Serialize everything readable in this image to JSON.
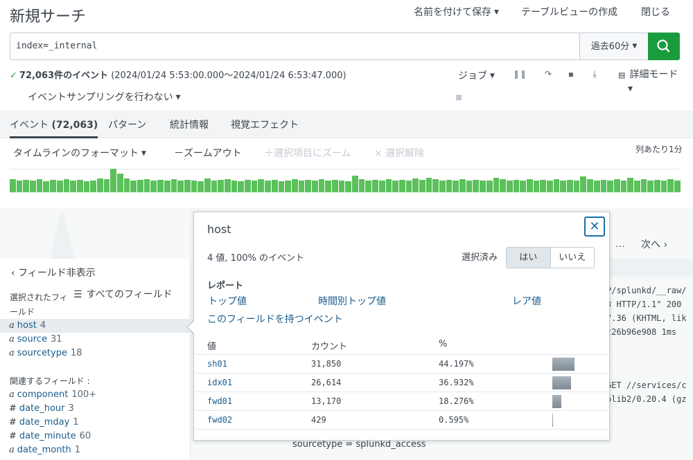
{
  "header": {
    "title": "新規サーチ",
    "save_as": "名前を付けて保存",
    "table_view": "テーブルビューの作成",
    "close": "閉じる"
  },
  "search": {
    "query": "index=_internal",
    "time_range": "過去60分"
  },
  "status": {
    "count_text": "72,063件のイベント",
    "range_text": "(2024/01/24 5:53:00.000～2024/01/24 6:53:47.000)",
    "sampling": "イベントサンプリングを行わない",
    "job": "ジョブ",
    "mode": "詳細モード"
  },
  "tabs": {
    "events_label": "イベント",
    "events_count": "(72,063)",
    "patterns": "パターン",
    "statistics": "統計情報",
    "visualization": "視覚エフェクト"
  },
  "timeline": {
    "format": "タイムラインのフォーマット",
    "zoom_out": "－ズームアウト",
    "zoom_selection": "＋選択項目にズーム",
    "deselect": "× 選択解除",
    "per_column": "列あたり1分",
    "bar_values": [
      0.55,
      0.5,
      0.52,
      0.5,
      0.55,
      0.48,
      0.52,
      0.5,
      0.55,
      0.5,
      0.52,
      0.48,
      0.5,
      0.6,
      0.55,
      1.0,
      0.8,
      0.58,
      0.5,
      0.52,
      0.55,
      0.5,
      0.52,
      0.5,
      0.55,
      0.5,
      0.52,
      0.5,
      0.48,
      0.6,
      0.5,
      0.52,
      0.55,
      0.5,
      0.48,
      0.52,
      0.5,
      0.55,
      0.5,
      0.52,
      0.48,
      0.5,
      0.55,
      0.5,
      0.52,
      0.5,
      0.55,
      0.5,
      0.52,
      0.5,
      0.48,
      0.7,
      0.55,
      0.5,
      0.52,
      0.5,
      0.55,
      0.5,
      0.52,
      0.5,
      0.58,
      0.52,
      0.62,
      0.55,
      0.5,
      0.52,
      0.5,
      0.55,
      0.5,
      0.52,
      0.5,
      0.5,
      0.62,
      0.55,
      0.5,
      0.52,
      0.5,
      0.55,
      0.5,
      0.52,
      0.5,
      0.55,
      0.5,
      0.52,
      0.5,
      0.68,
      0.55,
      0.5,
      0.52,
      0.5,
      0.55,
      0.5,
      0.62,
      0.5,
      0.55,
      0.5,
      0.52,
      0.5,
      0.55,
      0.5
    ]
  },
  "pagination": {
    "ellipsis": "…",
    "next": "次へ ›"
  },
  "sidebar": {
    "hide_fields": "‹ フィールド非表示",
    "all_fields": "すべてのフィールド",
    "selected_label": "選択されたフィールド",
    "related_label": "関連するフィールド :",
    "selected_fields": [
      {
        "type": "a",
        "name": "host",
        "count": "4"
      },
      {
        "type": "a",
        "name": "source",
        "count": "31"
      },
      {
        "type": "a",
        "name": "sourcetype",
        "count": "18"
      }
    ],
    "related_fields": [
      {
        "type": "a",
        "name": "component",
        "count": "100+"
      },
      {
        "type": "#",
        "name": "date_hour",
        "count": "3"
      },
      {
        "type": "#",
        "name": "date_mday",
        "count": "1"
      },
      {
        "type": "#",
        "name": "date_minute",
        "count": "60"
      },
      {
        "type": "a",
        "name": "date_month",
        "count": "1"
      }
    ]
  },
  "raw_events": {
    "lines_a": [
      "P/splunkd/__raw/",
      "3 HTTP/1.1\" 200",
      "7.36 (KHTML, lik",
      "c26b96e908 1ms"
    ],
    "lines_b": [
      "GET //services/c",
      "plib2/0.20.4 (gz"
    ],
    "sourcetype_line": "sourcetype = splunkd_access"
  },
  "popover": {
    "title": "host",
    "close_symbol": "✕",
    "summary": "4 値, 100% のイベント",
    "selected_label": "選択済み",
    "yes": "はい",
    "no": "いいえ",
    "report_heading": "レポート",
    "top_values": "トップ値",
    "top_values_by_time": "時間別トップ値",
    "rare_values": "レア値",
    "events_with_field": "このフィールドを持つイベント",
    "col_value": "値",
    "col_count": "カウント",
    "col_percent": "%",
    "rows": [
      {
        "value": "sh01",
        "count": "31,850",
        "percent": "44.197%",
        "fraction": 0.44197
      },
      {
        "value": "idx01",
        "count": "26,614",
        "percent": "36.932%",
        "fraction": 0.36932
      },
      {
        "value": "fwd01",
        "count": "13,170",
        "percent": "18.276%",
        "fraction": 0.18276
      },
      {
        "value": "fwd02",
        "count": "429",
        "percent": "0.595%",
        "fraction": 0.00595
      }
    ]
  }
}
